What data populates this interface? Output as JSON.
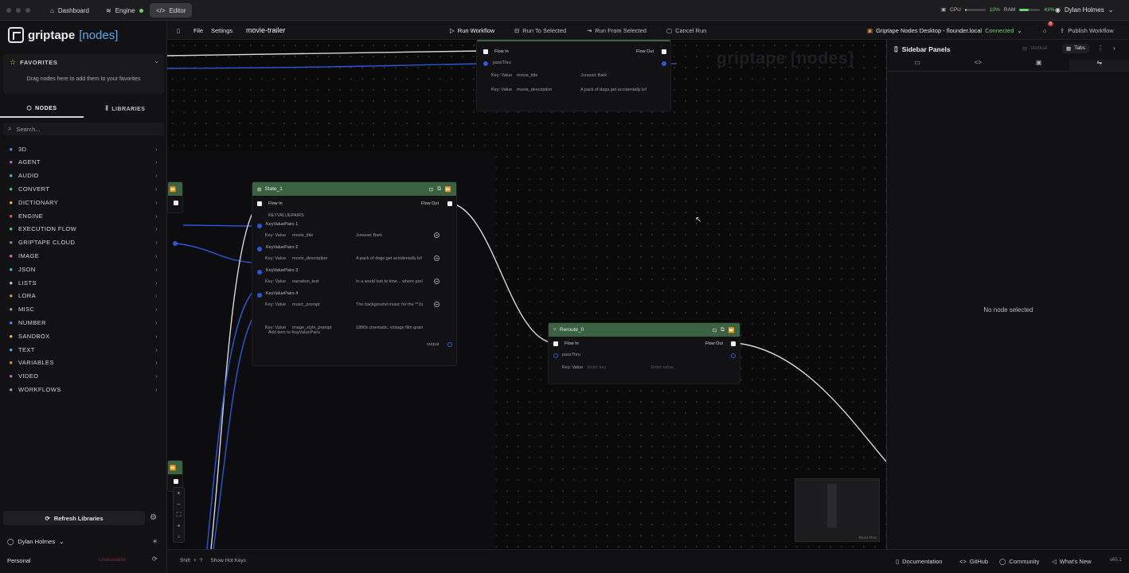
{
  "titlebar": {
    "tabs": [
      {
        "icon": "home-icon",
        "label": "Dashboard"
      },
      {
        "icon": "engine-icon",
        "label": "Engine"
      },
      {
        "icon": "code-icon",
        "label": "Editor"
      }
    ],
    "cpu_label": "CPU",
    "cpu_value": "10%",
    "cpu_fill": 0.1,
    "ram_label": "RAM",
    "ram_value": "43%",
    "ram_fill": 0.43,
    "user": "Dylan Holmes",
    "status_color": "#6fd36f"
  },
  "sidebar": {
    "logo_main": "griptape",
    "logo_bracket": "[nodes]",
    "favorites_title": "FAVORITES",
    "favorites_hint": "Drag nodes here to add them to your favorites",
    "tab_nodes": "NODES",
    "tab_libraries": "LIBRARIES",
    "search_placeholder": "Search...",
    "categories": [
      {
        "label": "3D",
        "icon": "cube-icon",
        "color": "#5b8dee"
      },
      {
        "label": "AGENT",
        "icon": "agent-icon",
        "color": "#b06be0"
      },
      {
        "label": "AUDIO",
        "icon": "audio-icon",
        "color": "#4ab4f0"
      },
      {
        "label": "CONVERT",
        "icon": "convert-icon",
        "color": "#3fc98a"
      },
      {
        "label": "DICTIONARY",
        "icon": "dictionary-icon",
        "color": "#e0c04a"
      },
      {
        "label": "ENGINE",
        "icon": "engine-icon",
        "color": "#e05b5b"
      },
      {
        "label": "EXECUTION FLOW",
        "icon": "flow-icon",
        "color": "#5bd35b"
      },
      {
        "label": "GRIPTAPE CLOUD",
        "icon": "cloud-icon",
        "color": "#8a8a8a"
      },
      {
        "label": "IMAGE",
        "icon": "image-icon",
        "color": "#e06bc0"
      },
      {
        "label": "JSON",
        "icon": "json-icon",
        "color": "#4ab4f0"
      },
      {
        "label": "LISTS",
        "icon": "list-icon",
        "color": "#c9c9c9"
      },
      {
        "label": "LORA",
        "icon": "lora-icon",
        "color": "#e0923e"
      },
      {
        "label": "MISC",
        "icon": "folder-icon",
        "color": "#9a9a9a"
      },
      {
        "label": "NUMBER",
        "icon": "number-icon",
        "color": "#5b8dee"
      },
      {
        "label": "SANDBOX",
        "icon": "sandbox-icon",
        "color": "#e0c04a"
      },
      {
        "label": "TEXT",
        "icon": "text-icon",
        "color": "#4ab4f0"
      },
      {
        "label": "VARIABLES",
        "icon": "variables-icon",
        "color": "#e0923e"
      },
      {
        "label": "VIDEO",
        "icon": "video-icon",
        "color": "#b06be0"
      },
      {
        "label": "WORKFLOWS",
        "icon": "workflow-icon",
        "color": "#9a9a9a"
      }
    ],
    "refresh_label": "Refresh Libraries",
    "user": "Dylan Holmes",
    "workspace": "Personal",
    "workspace_badge": "Unavailable"
  },
  "toolbar": {
    "file": "File",
    "settings": "Settings",
    "workflow_name": "movie-trailer",
    "run_workflow": "Run Workflow",
    "run_to_selected": "Run To Selected",
    "run_from_selected": "Run From Selected",
    "cancel_run": "Cancel Run",
    "engine_name": "Griptape Nodes Desktop - flounder.local",
    "engine_status": "Connected",
    "publish": "Publish Workflow",
    "notif_count": "8"
  },
  "canvas": {
    "watermark": "griptape [nodes]",
    "top_node": {
      "flow_in": "Flow In",
      "flow_out": "Flow Out",
      "passthru": "passThru",
      "rows": [
        {
          "key": "Key: Value",
          "k": "movie_title",
          "v": "Jurassic Bark"
        },
        {
          "key": "Key: Value",
          "k": "movie_description",
          "v": "A pack of dogs get accidentally lef"
        }
      ]
    },
    "state_node": {
      "title": "State_1",
      "flow_in": "Flow In",
      "flow_out": "Flow Out",
      "section": "KEYVALUEPAIRS",
      "pairs": [
        {
          "name": "KeyValuePairs 1",
          "key": "Key: Value",
          "k": "movie_title",
          "v": "Jurassic Bark"
        },
        {
          "name": "KeyValuePairs 2",
          "key": "Key: Value",
          "k": "movie_description",
          "v": "A pack of dogs get accidentally lef"
        },
        {
          "name": "KeyValuePairs 3",
          "key": "Key: Value",
          "k": "narration_text",
          "v": "In a world lost to time... where prel"
        },
        {
          "name": "KeyValuePairs 4",
          "key": "Key: Value",
          "k": "music_prompt",
          "v": "The background music for the **Ju"
        },
        {
          "name": "",
          "key": "Key: Value",
          "k": "image_style_prompt",
          "v": "1950s cinematic, vintage film grain"
        }
      ],
      "add_item": "Add item to KeyValuePairs",
      "output": "output"
    },
    "reroute_node": {
      "title": "Reroute_0",
      "flow_in": "Flow In",
      "flow_out": "Flow Out",
      "passthru": "passThru",
      "key": "Key: Value",
      "key_placeholder": "Enter key",
      "value_placeholder": "Enter value"
    },
    "minimap_label": "React Flow"
  },
  "right_panel": {
    "title": "Sidebar Panels",
    "vertical": "Vertical",
    "tabs_label": "Tabs",
    "empty": "No node selected"
  },
  "statusbar": {
    "shift": "Shift",
    "plus": "+",
    "question": "?",
    "hotkeys": "Show Hot Keys",
    "documentation": "Documentation",
    "github": "GitHub",
    "community": "Community",
    "whats_new": "What's New",
    "version": "v65.1"
  }
}
